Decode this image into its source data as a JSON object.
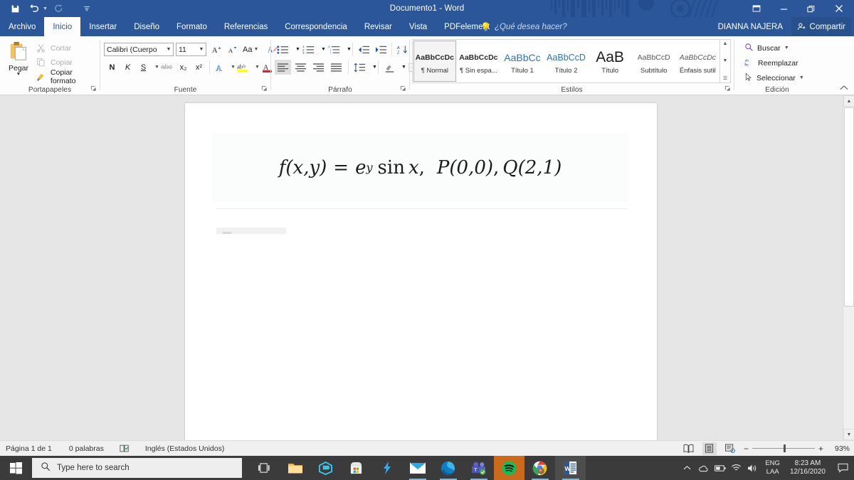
{
  "titlebar": {
    "document_title": "Documento1 - Word",
    "quick_access": [
      {
        "name": "save",
        "glyph": "💾"
      },
      {
        "name": "undo",
        "glyph": "↶"
      },
      {
        "name": "redo",
        "glyph": "↻"
      },
      {
        "name": "customize-qat",
        "glyph": "⩛"
      }
    ],
    "window_controls": [
      {
        "name": "ribbon-display-options",
        "glyph": "❐"
      },
      {
        "name": "minimize",
        "glyph": "—"
      },
      {
        "name": "restore",
        "glyph": "❐"
      },
      {
        "name": "close",
        "glyph": "✕"
      }
    ],
    "accent_color": "#2b579a"
  },
  "tabs": [
    {
      "label": "Archivo",
      "active": false
    },
    {
      "label": "Inicio",
      "active": true
    },
    {
      "label": "Insertar",
      "active": false
    },
    {
      "label": "Diseño",
      "active": false
    },
    {
      "label": "Formato",
      "active": false
    },
    {
      "label": "Referencias",
      "active": false
    },
    {
      "label": "Correspondencia",
      "active": false
    },
    {
      "label": "Revisar",
      "active": false
    },
    {
      "label": "Vista",
      "active": false
    },
    {
      "label": "PDFelement",
      "active": false
    }
  ],
  "tell_me": "¿Qué desea hacer?",
  "account": {
    "user_name": "DIANNA NAJERA",
    "share_label": "Compartir"
  },
  "ribbon": {
    "clipboard": {
      "group_label": "Portapapeles",
      "paste_label": "Pegar",
      "items": [
        {
          "label": "Cortar",
          "icon": "scissors-icon",
          "enabled": false
        },
        {
          "label": "Copiar",
          "icon": "copy-icon",
          "enabled": false
        },
        {
          "label": "Copiar formato",
          "icon": "format-painter-icon",
          "enabled": true
        }
      ]
    },
    "font": {
      "group_label": "Fuente",
      "font_family": "Calibri (Cuerpo",
      "font_size": "11",
      "buttons_row1": [
        {
          "name": "grow-font",
          "label": "A˄"
        },
        {
          "name": "shrink-font",
          "label": "A˅"
        },
        {
          "name": "change-case",
          "label": "Aa",
          "caret": true
        },
        {
          "name": "clear-formatting",
          "label": "✐"
        }
      ],
      "buttons_row2": [
        {
          "name": "bold",
          "label": "N"
        },
        {
          "name": "italic",
          "label": "K"
        },
        {
          "name": "underline",
          "label": "S",
          "caret": true
        },
        {
          "name": "strikethrough",
          "label": "abc"
        },
        {
          "name": "subscript",
          "label": "x₂"
        },
        {
          "name": "superscript",
          "label": "x²"
        },
        {
          "name": "text-effects",
          "label": "A",
          "caret": true
        },
        {
          "name": "text-highlight-color",
          "label": "ab",
          "caret": true
        },
        {
          "name": "font-color",
          "label": "A",
          "caret": true
        }
      ]
    },
    "paragraph": {
      "group_label": "Párrafo",
      "buttons_row1": [
        {
          "name": "bullets",
          "caret": true
        },
        {
          "name": "numbering",
          "caret": true
        },
        {
          "name": "multilevel-list",
          "caret": true
        },
        {
          "name": "decrease-indent"
        },
        {
          "name": "increase-indent"
        },
        {
          "name": "sort"
        },
        {
          "name": "show-formatting-marks",
          "label": "¶"
        }
      ],
      "buttons_row2": [
        {
          "name": "align-left",
          "active": true
        },
        {
          "name": "align-center"
        },
        {
          "name": "align-right"
        },
        {
          "name": "justify"
        },
        {
          "name": "line-spacing",
          "caret": true
        },
        {
          "name": "shading",
          "caret": true
        },
        {
          "name": "borders",
          "caret": true
        }
      ]
    },
    "styles": {
      "group_label": "Estilos",
      "items": [
        {
          "preview": "AaBbCcDc",
          "name": "¶ Normal",
          "selected": true,
          "style": "normal"
        },
        {
          "preview": "AaBbCcDc",
          "name": "¶ Sin espa...",
          "selected": false,
          "style": "normal"
        },
        {
          "preview": "AaBbCс",
          "name": "Título 1",
          "selected": false,
          "style": "heading1"
        },
        {
          "preview": "AaBbCcD",
          "name": "Título 2",
          "selected": false,
          "style": "heading2"
        },
        {
          "preview": "AaB",
          "name": "Título",
          "selected": false,
          "style": "title"
        },
        {
          "preview": "AaBbCcD",
          "name": "Subtítulo",
          "selected": false,
          "style": "subtitle"
        },
        {
          "preview": "AaBbCcDc",
          "name": "Énfasis sutil",
          "selected": false,
          "style": "emphasis"
        }
      ]
    },
    "editing": {
      "group_label": "Edición",
      "items": [
        {
          "label": "Buscar",
          "icon": "search-icon",
          "caret": true
        },
        {
          "label": "Reemplazar",
          "icon": "replace-icon",
          "caret": false
        },
        {
          "label": "Seleccionar",
          "icon": "select-icon",
          "caret": true
        }
      ]
    }
  },
  "document": {
    "formula": {
      "function": "f(x,y)",
      "equals": "=",
      "base": "e",
      "exponent": "y",
      "trig": "sin",
      "variable": "x",
      "comma": ",",
      "point_p": "P(0,0)",
      "point_q": "Q(2,1)",
      "full_text": "f(x,y) = e^y sin x,  P(0,0), Q(2,1)"
    }
  },
  "statusbar": {
    "page_info": "Página 1 de 1",
    "word_count": "0 palabras",
    "proofing_icon": "proofing-errors-icon",
    "language": "Inglés (Estados Unidos)",
    "views": [
      {
        "name": "read-mode",
        "glyph": "📖",
        "active": false
      },
      {
        "name": "print-layout",
        "glyph": "☰",
        "active": true
      },
      {
        "name": "web-layout",
        "glyph": "🗎",
        "active": false
      }
    ],
    "zoom_out": "−",
    "zoom_in": "+",
    "zoom_level": "93%"
  },
  "taskbar": {
    "start_icon": "windows-start-icon",
    "search_placeholder": "Type here to search",
    "search_icon": "search-icon",
    "apps": [
      {
        "name": "task-view-icon",
        "running": false
      },
      {
        "name": "file-explorer-icon",
        "running": false
      },
      {
        "name": "3d-viewer-icon",
        "running": false
      },
      {
        "name": "microsoft-store-icon",
        "running": false
      },
      {
        "name": "epic-games-icon",
        "running": false
      },
      {
        "name": "mail-icon",
        "running": true
      },
      {
        "name": "microsoft-edge-icon",
        "running": true
      },
      {
        "name": "microsoft-teams-icon",
        "running": true
      },
      {
        "name": "spotify-icon",
        "running": true
      },
      {
        "name": "google-chrome-icon",
        "running": true
      },
      {
        "name": "microsoft-word-icon",
        "running": true
      }
    ],
    "tray": {
      "show_hidden_icons": "chevron-up-icon",
      "icons": [
        {
          "name": "onedrive-icon"
        },
        {
          "name": "battery-icon"
        },
        {
          "name": "wifi-icon"
        },
        {
          "name": "volume-icon"
        }
      ],
      "language_line1": "ENG",
      "language_line2": "LAA",
      "time": "8:23 AM",
      "date": "12/16/2020",
      "action_center": "action-center-icon"
    }
  }
}
